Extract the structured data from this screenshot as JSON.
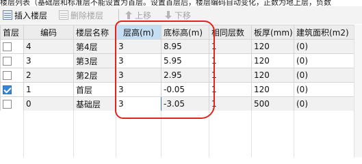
{
  "top_note": "楼层列表（基础层和标准层不能设置为首层。设置首层后，楼层编码自动变化，正数为地上层，负数",
  "toolbar": {
    "insert": "插入楼层",
    "delete": "删除楼层",
    "up": "上移",
    "down": "下移"
  },
  "columns": [
    "首层",
    "编码",
    "楼层名称",
    "层高(m)",
    "底标高(m)",
    "相同层数",
    "板厚(mm)",
    "建筑面积(m2)"
  ],
  "rows": [
    {
      "first": false,
      "code": "4",
      "name": "第4层",
      "height": "3",
      "elev": "8.95",
      "same": "1",
      "slab": "120",
      "area": "(0)"
    },
    {
      "first": false,
      "code": "3",
      "name": "第3层",
      "height": "3",
      "elev": "5.95",
      "same": "1",
      "slab": "120",
      "area": "(0)"
    },
    {
      "first": false,
      "code": "2",
      "name": "第2层",
      "height": "3",
      "elev": "2.95",
      "same": "1",
      "slab": "120",
      "area": "(0)"
    },
    {
      "first": true,
      "code": "1",
      "name": "首层",
      "height": "3",
      "elev": "-0.05",
      "same": "1",
      "slab": "120",
      "area": "(0)"
    },
    {
      "first": false,
      "code": "0",
      "name": "基础层",
      "height": "3",
      "elev": "-3.05",
      "same": "1",
      "slab": "500",
      "area": "(0)"
    }
  ],
  "colors": {
    "selected_header": "#c5def4",
    "checkbox": "#3a86d4",
    "annotation": "#e2231a"
  }
}
